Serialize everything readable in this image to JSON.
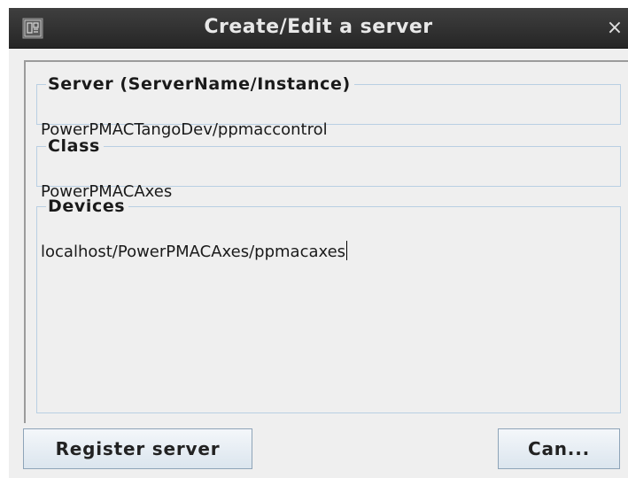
{
  "window": {
    "title": "Create/Edit a server",
    "close_glyph": "×",
    "app_icon": "java-window-icon"
  },
  "form": {
    "server": {
      "legend": "Server  (ServerName/Instance)",
      "value": "PowerPMACTangoDev/ppmaccontrol"
    },
    "class": {
      "legend": "Class",
      "value": "PowerPMACAxes"
    },
    "devices": {
      "legend": "Devices",
      "value": "localhost/PowerPMACAxes/ppmacaxes"
    }
  },
  "buttons": {
    "register_label": "Register server",
    "cancel_label": "Can..."
  },
  "colors": {
    "titlebar": "#2e2e2e",
    "window_bg": "#efefef",
    "fieldset_border": "#b9cfe3",
    "button_border": "#8ea4b8"
  }
}
